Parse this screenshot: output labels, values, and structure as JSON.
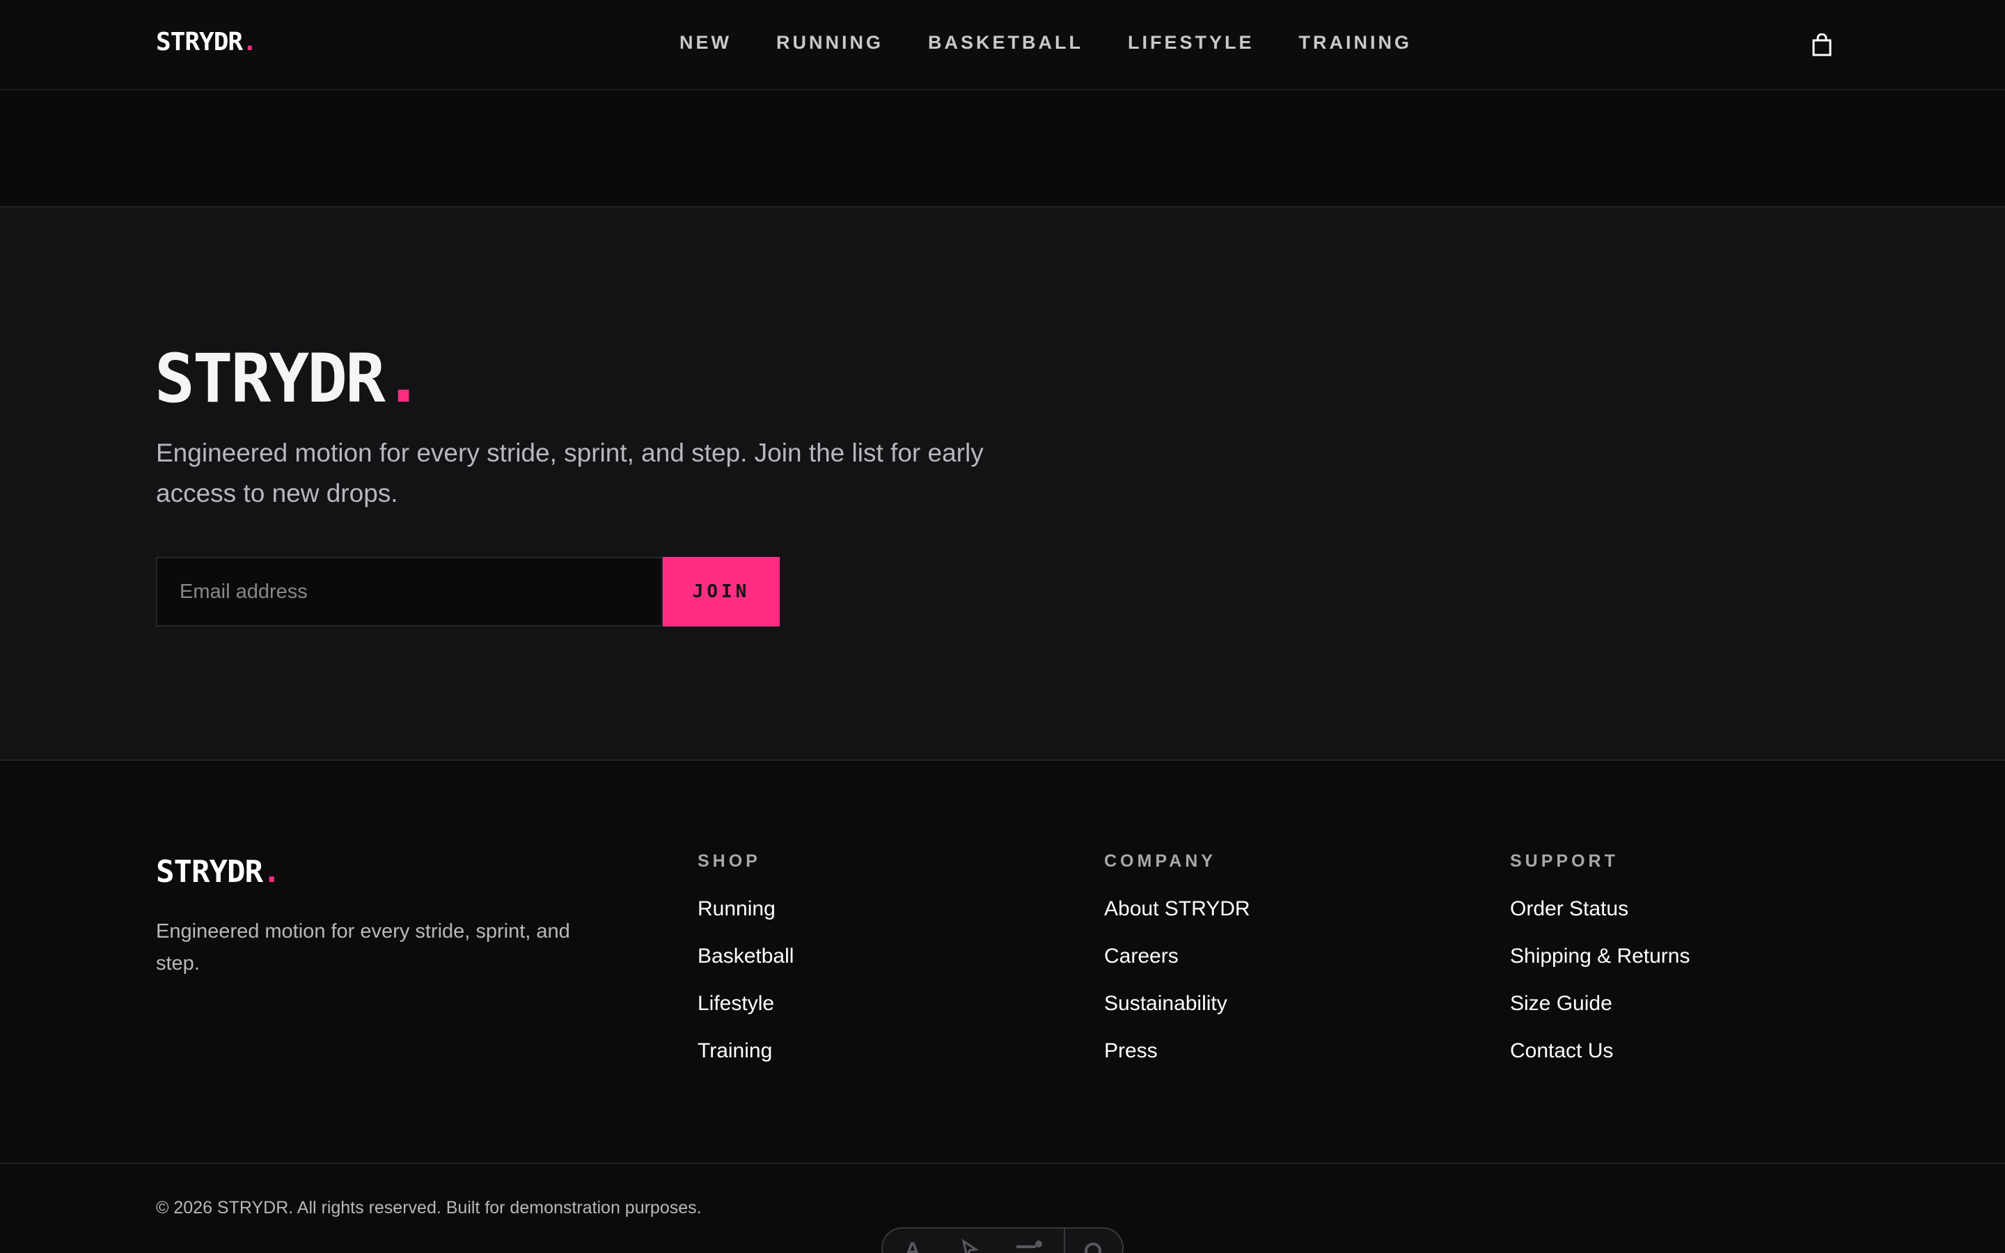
{
  "brand": {
    "name": "STRYDR",
    "dot": ".",
    "accent": "#ff2e83"
  },
  "nav": {
    "links": [
      "NEW",
      "RUNNING",
      "BASKETBALL",
      "LIFESTYLE",
      "TRAINING"
    ],
    "cart_icon": "shopping-bag-icon"
  },
  "newsletter": {
    "tagline": "Engineered motion for every stride, sprint, and step. Join the list for early access to new drops.",
    "email_placeholder": "Email address",
    "join_label": "JOIN"
  },
  "footer": {
    "description": "Engineered motion for every stride, sprint, and step.",
    "columns": [
      {
        "heading": "SHOP",
        "links": [
          "Running",
          "Basketball",
          "Lifestyle",
          "Training"
        ]
      },
      {
        "heading": "COMPANY",
        "links": [
          "About STRYDR",
          "Careers",
          "Sustainability",
          "Press"
        ]
      },
      {
        "heading": "SUPPORT",
        "links": [
          "Order Status",
          "Shipping & Returns",
          "Size Guide",
          "Contact Us"
        ]
      }
    ],
    "copyright": "© 2026 STRYDR. All rights reserved. Built for demonstration purposes."
  },
  "toolbar": {
    "icons": [
      "text-icon",
      "pointer-icon",
      "slider-icon",
      "gear-icon"
    ]
  }
}
